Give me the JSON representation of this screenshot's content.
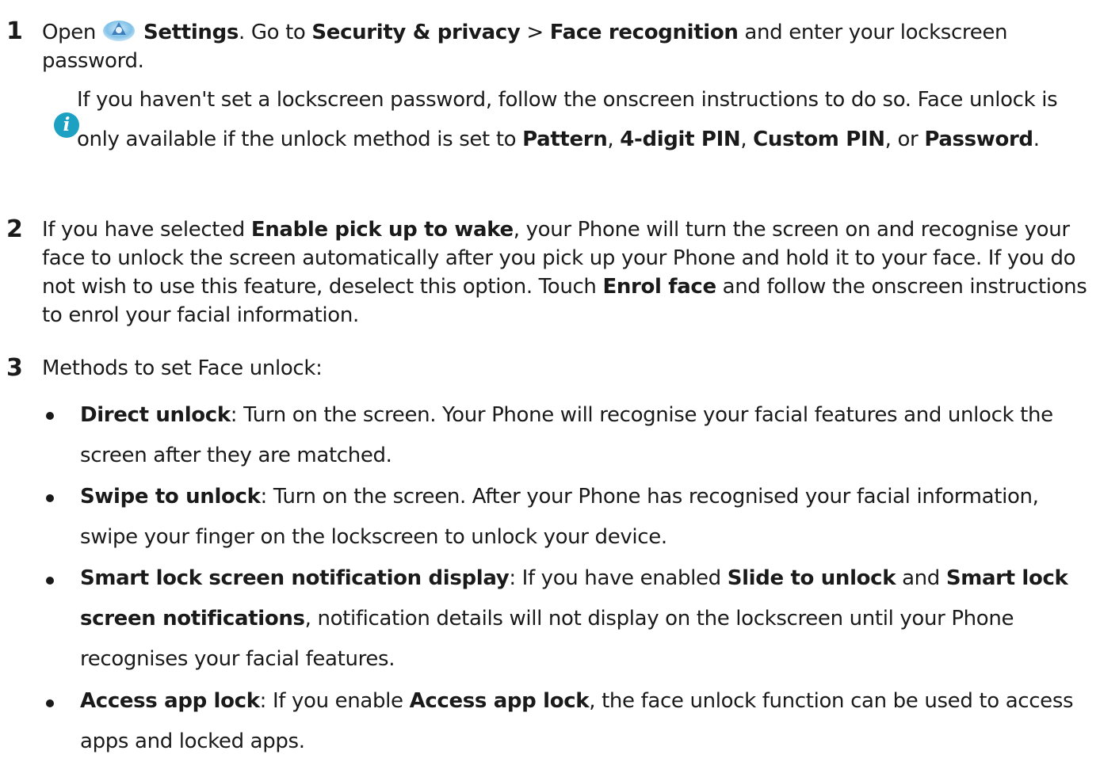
{
  "steps": [
    {
      "number": "1",
      "open": "Open",
      "settings": "Settings",
      "go_to": ". Go to ",
      "security_privacy": "Security & privacy",
      "arrow": " > ",
      "face_recognition": "Face recognition",
      "rest": " and enter your lockscreen password.",
      "note": {
        "icon": "info-icon",
        "icon_glyph": "i",
        "part1": "If you haven't set a lockscreen password, follow the onscreen instructions to do so. Face unlock is only available if the unlock method is set to ",
        "pattern": "Pattern",
        "sep1": ", ",
        "four_digit_pin": "4-digit PIN",
        "sep2": ", ",
        "custom_pin": "Custom PIN",
        "sep3": ", or ",
        "password": "Password",
        "end": "."
      }
    },
    {
      "number": "2",
      "part1": "If you have selected ",
      "enable_pick_up": "Enable pick up to wake",
      "part2": ", your Phone will turn the screen on and recognise your face to unlock the screen automatically after you pick up your Phone and hold it to your face. If you do not wish to use this feature, deselect this option. Touch ",
      "enrol_face": "Enrol face",
      "part3": " and follow the onscreen instructions to enrol your facial information."
    },
    {
      "number": "3",
      "text": "Methods to set Face unlock:",
      "bullets": [
        {
          "title": "Direct unlock",
          "text": ": Turn on the screen. Your Phone will recognise your facial features and unlock the screen after they are matched."
        },
        {
          "title": "Swipe to unlock",
          "text": ": Turn on the screen. After your Phone has recognised your facial information, swipe your finger on the lockscreen to unlock your device."
        },
        {
          "title": "Smart lock screen notification display",
          "text1": ": If you have enabled ",
          "slide_to_unlock": "Slide to unlock",
          "and": " and ",
          "smart_lock": "Smart lock screen notifications",
          "text2": ", notification details will not display on the lockscreen until your Phone recognises your facial features."
        },
        {
          "title": "Access app lock",
          "text1": ": If you enable ",
          "access_app_lock": "Access app lock",
          "text2": ", the face unlock function can be used to access apps and locked apps."
        }
      ]
    }
  ],
  "colors": {
    "text": "#1a1a1a",
    "info_icon": "#1da1c2",
    "settings_icon_blue": "#6ab6e4"
  }
}
